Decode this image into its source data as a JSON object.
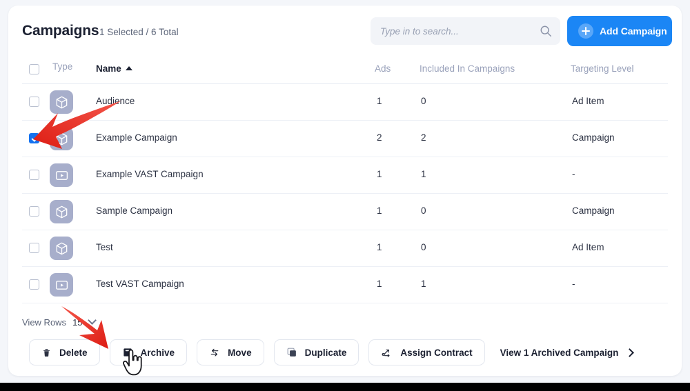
{
  "header": {
    "title": "Campaigns",
    "selected_summary": "1 Selected / 6 Total",
    "search_placeholder": "Type in to search...",
    "search_value": "",
    "search_icon": "search-icon",
    "add_button_label": "Add Campaign",
    "add_button_color": "#1b86f5"
  },
  "table": {
    "columns": [
      {
        "key": "type",
        "label": "Type"
      },
      {
        "key": "name",
        "label": "Name",
        "sorted": "asc"
      },
      {
        "key": "ads",
        "label": "Ads"
      },
      {
        "key": "included",
        "label": "Included In Campaigns"
      },
      {
        "key": "targeting",
        "label": "Targeting Level"
      }
    ],
    "select_all_checked": false,
    "rows": [
      {
        "checked": false,
        "type_icon": "cube-icon",
        "name": "Audience",
        "ads": "1",
        "included": "0",
        "targeting": "Ad Item"
      },
      {
        "checked": true,
        "type_icon": "cube-icon",
        "name": "Example Campaign",
        "ads": "2",
        "included": "2",
        "targeting": "Campaign"
      },
      {
        "checked": false,
        "type_icon": "video-icon",
        "name": "Example VAST Campaign",
        "ads": "1",
        "included": "1",
        "targeting": "-"
      },
      {
        "checked": false,
        "type_icon": "cube-icon",
        "name": "Sample Campaign",
        "ads": "1",
        "included": "0",
        "targeting": "Campaign"
      },
      {
        "checked": false,
        "type_icon": "cube-icon",
        "name": "Test",
        "ads": "1",
        "included": "0",
        "targeting": "Ad Item"
      },
      {
        "checked": false,
        "type_icon": "video-icon",
        "name": "Test VAST Campaign",
        "ads": "1",
        "included": "1",
        "targeting": "-"
      }
    ]
  },
  "footer": {
    "view_rows_label": "View Rows",
    "view_rows_value": "15",
    "actions": [
      {
        "label": "Delete",
        "icon": "trash-icon"
      },
      {
        "label": "Archive",
        "icon": "archive-box-icon"
      },
      {
        "label": "Move",
        "icon": "move-arrows-icon"
      },
      {
        "label": "Duplicate",
        "icon": "duplicate-icon"
      },
      {
        "label": "Assign Contract",
        "icon": "assign-contract-icon"
      }
    ],
    "view_archived_label": "View 1 Archived Campaign"
  },
  "annotations": {
    "arrow_color": "#e8332a",
    "arrow_1_target": "row-checkbox-example-campaign",
    "arrow_2_target": "archive-button",
    "cursor": "pointing-hand-cursor"
  }
}
